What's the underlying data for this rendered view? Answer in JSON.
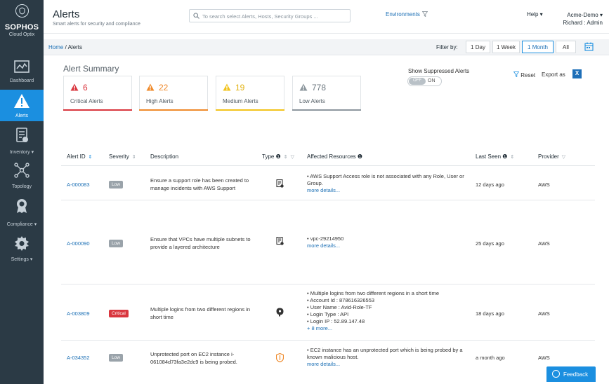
{
  "brand": {
    "name": "SOPHOS",
    "product": "Cloud Optix"
  },
  "nav": [
    {
      "label": "Dashboard",
      "icon": "dashboard-icon"
    },
    {
      "label": "Alerts",
      "icon": "alert-icon",
      "active": true
    },
    {
      "label": "Inventory ▾",
      "icon": "inventory-icon"
    },
    {
      "label": "Topology",
      "icon": "topology-icon"
    },
    {
      "label": "Compliance ▾",
      "icon": "compliance-icon"
    },
    {
      "label": "Settings ▾",
      "icon": "settings-icon"
    }
  ],
  "header": {
    "title": "Alerts",
    "subtitle": "Smart alerts for security and compliance",
    "search_placeholder": "To search select Alerts, Hosts, Security Groups ...",
    "environments": "Environments",
    "help": "Help ▾",
    "account": "Acme-Demo ▾",
    "user": "Richard : Admin"
  },
  "breadcrumb": {
    "home": "Home",
    "sep": " / ",
    "current": "Alerts"
  },
  "filter": {
    "label": "Filter by:",
    "options": [
      "1 Day",
      "1 Week",
      "1 Month",
      "All"
    ],
    "selected": "1 Month"
  },
  "summary": {
    "title": "Alert Summary",
    "cards": [
      {
        "count": "6",
        "label": "Critical Alerts",
        "color": "#d9363e"
      },
      {
        "count": "22",
        "label": "High Alerts",
        "color": "#ef8a2b"
      },
      {
        "count": "19",
        "label": "Medium Alerts",
        "color": "#f2c31b"
      },
      {
        "count": "778",
        "label": "Low Alerts",
        "color": "#8d979e"
      }
    ],
    "suppressed_label": "Show Suppressed Alerts",
    "toggle_off": "OFF",
    "toggle_on": "ON",
    "reset": "Reset",
    "export": "Export as"
  },
  "table": {
    "columns": [
      "Alert ID",
      "Severity",
      "Description",
      "Type",
      "Affected Resources",
      "Last Seen",
      "Provider"
    ],
    "rows": [
      {
        "id": "A-000083",
        "severity": "Low",
        "sev_class": "low",
        "description": "Ensure a support role has been created to manage incidents with AWS Support",
        "resources": [
          "• AWS Support Access role is not associated with any Role, User or Group."
        ],
        "more": "more details...",
        "last_seen": "12 days ago",
        "provider": "AWS"
      },
      {
        "id": "A-000090",
        "severity": "Low",
        "sev_class": "low",
        "description": "Ensure that VPCs have multiple subnets to provide a layered architecture",
        "resources": [
          "• vpc-29214950"
        ],
        "more": "more details...",
        "last_seen": "25 days ago",
        "provider": "AWS"
      },
      {
        "id": "A-003809",
        "severity": "Critical",
        "sev_class": "critical",
        "description": "Multiple logins from two different regions in short time",
        "resources": [
          "• Multiple logins from two different regions in a short time",
          "• Account Id : 878616326553",
          "• User Name : Avid-Role-TF",
          "• Login Type : API",
          "• Login IP : 52.89.147.48"
        ],
        "more": "+ 8 more...",
        "last_seen": "18 days ago",
        "provider": "AWS"
      },
      {
        "id": "A-034352",
        "severity": "Low",
        "sev_class": "low",
        "description": "Unprotected port on EC2 instance i-061084d73fa3e2dc9 is being probed.",
        "resources": [
          "• EC2 instance has an unprotected port which is being probed by a known malicious host."
        ],
        "more": "more details...",
        "last_seen": "a month ago",
        "provider": "AWS"
      }
    ]
  },
  "feedback": "Feedback"
}
